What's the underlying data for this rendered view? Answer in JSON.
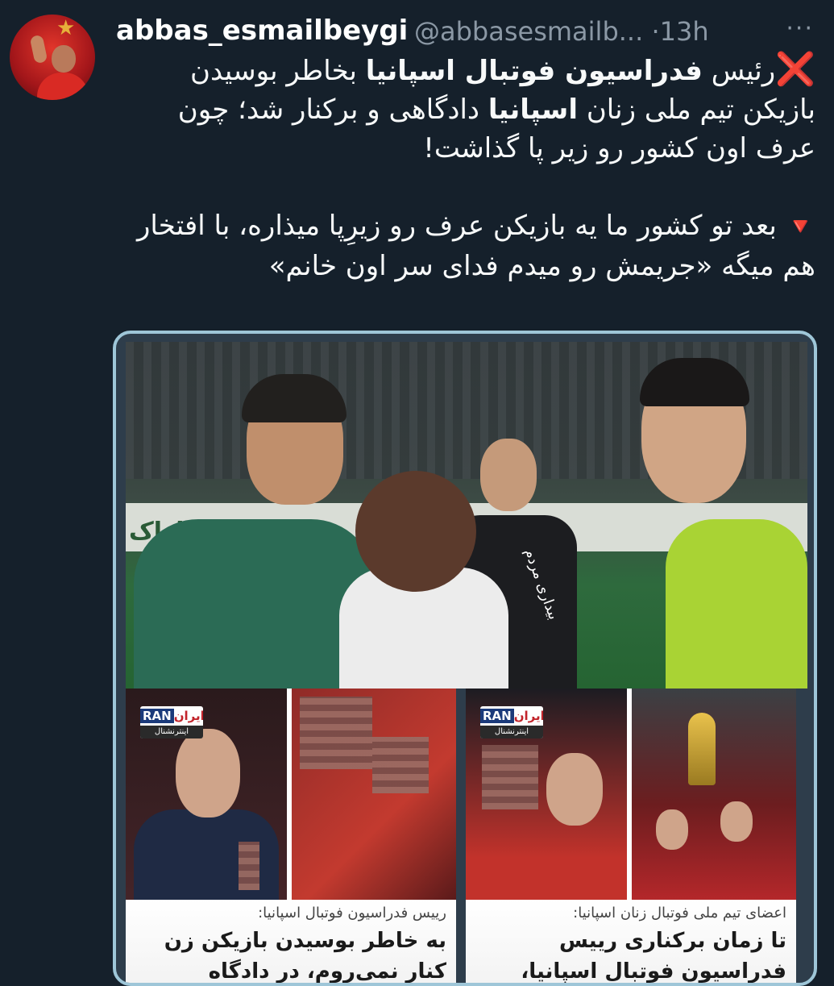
{
  "tweet": {
    "author_name": "abbas_esmailbeygi",
    "author_handle": "@abbasesmailb...",
    "separator": "·",
    "time": "13h",
    "more": "···",
    "paragraph1_mark": "❌",
    "paragraph1_a": "رئیس ",
    "paragraph1_bold1": "فدراسیون فوتبال اسپانیا",
    "paragraph1_b": " بخاطر بوسیدن بازیکن تیم ملی زنان ",
    "paragraph1_bold2": "اسپانیا",
    "paragraph1_c": " دادگاهی و برکنار شد؛ چون عرف اون کشور رو زیر پا گذاشت!",
    "paragraph2_mark": "🔻",
    "paragraph2": " بعد تو کشور ما یه بازیکن عرف رو زیرِپا میذاره، با افتخار هم میگه «جریمش رو میدم فدای سر اون خانم»"
  },
  "media": {
    "main_photo": {
      "wall_text": "م اراک",
      "signature": "بیداری مردم"
    },
    "news": [
      {
        "logo_en": "RAN",
        "logo_fa": "ایران",
        "logo_sub": "اینترنشنال",
        "kicker": "رییس فدراسیون فوتبال اسپانیا:",
        "headline": "به خاطر بوسیدن بازیکن زن کنار نمی‌روم، در دادگاه می‌جنگم"
      },
      {
        "logo_en": "RAN",
        "logo_fa": "ایران",
        "logo_sub": "اینترنشنال",
        "kicker": "اعضای تیم ملی فوتبال زنان اسپانیا:",
        "headline": "تا زمان برکناری رییس فدراسیون فوتبال اسپانیا، مسابقه نمی‌دهیم"
      }
    ]
  },
  "colors": {
    "background": "#15202b",
    "secondary_text": "#8b98a5",
    "frame_border": "#9ec6d8",
    "red_mark": "#e8232d"
  }
}
